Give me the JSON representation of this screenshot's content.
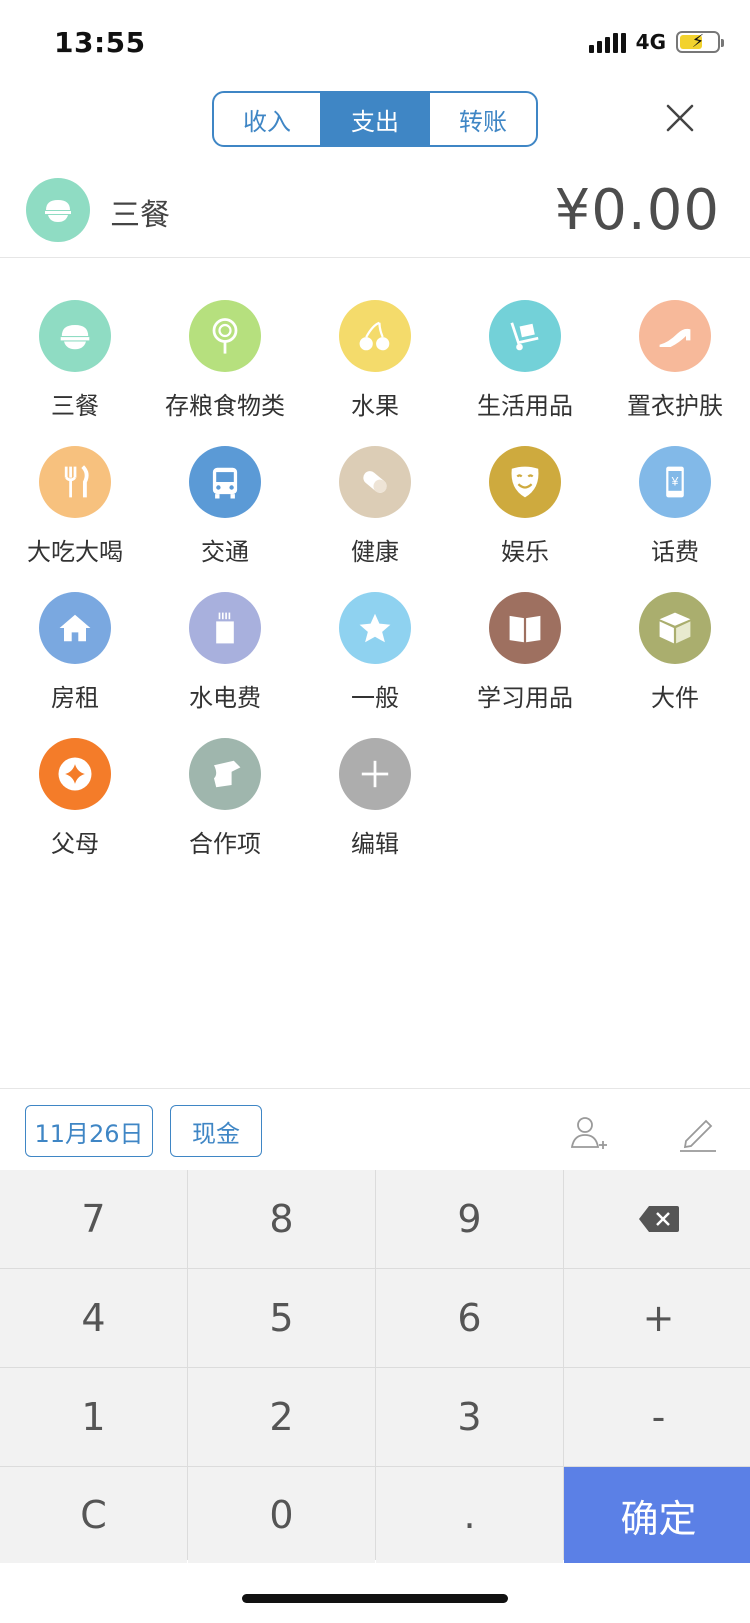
{
  "status": {
    "time": "13:55",
    "network": "4G"
  },
  "tabs": [
    {
      "label": "收入"
    },
    {
      "label": "支出",
      "active": true
    },
    {
      "label": "转账"
    }
  ],
  "selected": {
    "name": "三餐",
    "amount": "¥0.00",
    "color": "#8fdcc3"
  },
  "categories": [
    {
      "label": "三餐",
      "icon": "rice-bowl-icon",
      "color": "#8fdcc3"
    },
    {
      "label": "存粮食物类",
      "icon": "lollipop-icon",
      "color": "#b6e07e"
    },
    {
      "label": "水果",
      "icon": "cherry-icon",
      "color": "#f4db6b"
    },
    {
      "label": "生活用品",
      "icon": "hand-truck-icon",
      "color": "#73d1d8"
    },
    {
      "label": "置衣护肤",
      "icon": "high-heel-icon",
      "color": "#f7b99a"
    },
    {
      "label": "大吃大喝",
      "icon": "fork-knife-icon",
      "color": "#f7c17e"
    },
    {
      "label": "交通",
      "icon": "bus-icon",
      "color": "#5b9ad6"
    },
    {
      "label": "健康",
      "icon": "pill-icon",
      "color": "#dccdb6"
    },
    {
      "label": "娱乐",
      "icon": "mask-icon",
      "color": "#ceaa3e"
    },
    {
      "label": "话费",
      "icon": "phone-bill-icon",
      "color": "#82b9e8"
    },
    {
      "label": "房租",
      "icon": "house-icon",
      "color": "#7aa8e0"
    },
    {
      "label": "水电费",
      "icon": "meter-icon",
      "color": "#a8b0dd"
    },
    {
      "label": "一般",
      "icon": "star-icon",
      "color": "#8fd2f0"
    },
    {
      "label": "学习用品",
      "icon": "book-icon",
      "color": "#9e7060"
    },
    {
      "label": "大件",
      "icon": "box-icon",
      "color": "#aaae6e"
    },
    {
      "label": "父母",
      "icon": "coin-icon",
      "color": "#f47c29"
    },
    {
      "label": "合作项",
      "icon": "dog-icon",
      "color": "#9fb6ad"
    },
    {
      "label": "编辑",
      "icon": "plus-icon",
      "color": "#adadad"
    }
  ],
  "toolbar": {
    "date": "11月26日",
    "account": "现金"
  },
  "keypad": [
    {
      "label": "7"
    },
    {
      "label": "8"
    },
    {
      "label": "9"
    },
    {
      "label": ""
    },
    {
      "label": "4"
    },
    {
      "label": "5"
    },
    {
      "label": "6"
    },
    {
      "label": "+"
    },
    {
      "label": "1"
    },
    {
      "label": "2"
    },
    {
      "label": "3"
    },
    {
      "label": "-"
    },
    {
      "label": "C"
    },
    {
      "label": "0"
    },
    {
      "label": "."
    },
    {
      "label": "确定"
    }
  ]
}
